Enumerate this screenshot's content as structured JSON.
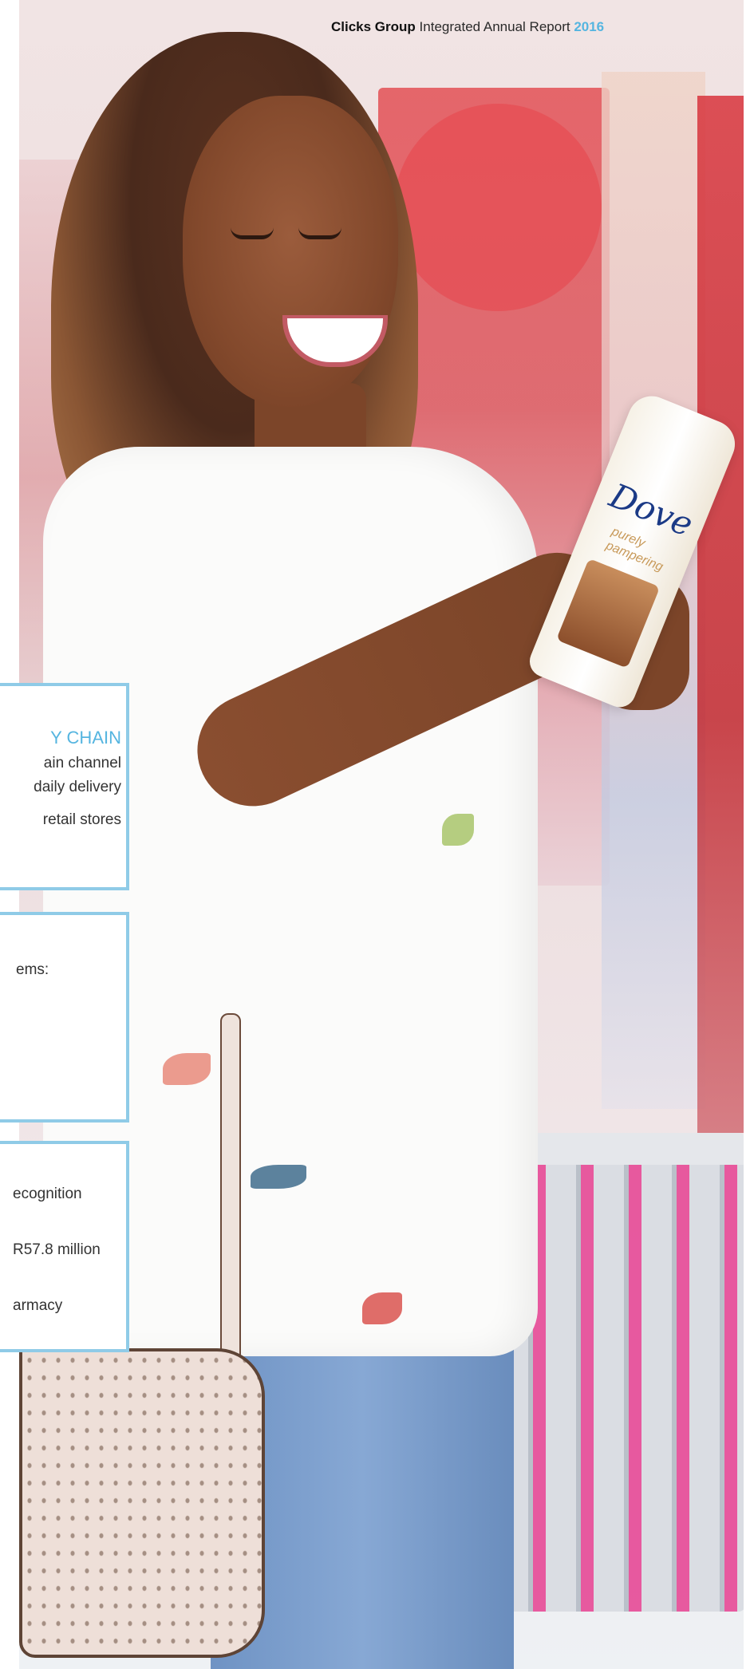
{
  "header": {
    "brand": "Clicks Group",
    "report": "Integrated Annual Report",
    "year": "2016"
  },
  "info_boxes": [
    {
      "title": "Y CHAIN",
      "lines": [
        "ain channel",
        "daily delivery",
        "retail stores"
      ]
    },
    {
      "lines": [
        "ems:"
      ]
    },
    {
      "lines": [
        "ecognition",
        "R57.8 million",
        "armacy"
      ]
    }
  ],
  "product": {
    "brand": "Dove",
    "subtitle": "purely pampering"
  },
  "colors": {
    "accent_blue": "#55b5e0",
    "box_border": "#8fcbe7",
    "retail_red": "#e13c42"
  }
}
